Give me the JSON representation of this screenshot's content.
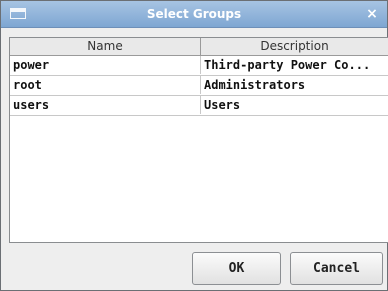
{
  "window": {
    "title": "Select Groups",
    "close_glyph": "×",
    "icon": "window-icon"
  },
  "table": {
    "columns": [
      "Name",
      "Description"
    ],
    "rows": [
      {
        "name": "power",
        "description": "Third-party Power Co..."
      },
      {
        "name": "root",
        "description": "Administrators"
      },
      {
        "name": "users",
        "description": "Users"
      }
    ]
  },
  "buttons": {
    "ok_label": "OK",
    "cancel_label": "Cancel"
  }
}
